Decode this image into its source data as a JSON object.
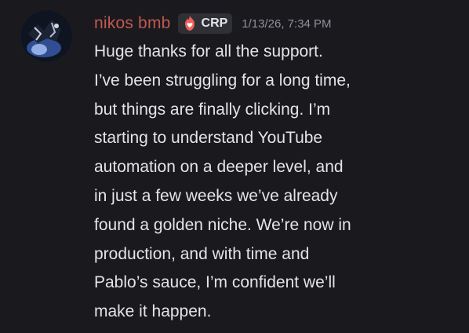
{
  "message": {
    "author": {
      "name": "nikos bmb",
      "name_color": "#c2574f",
      "avatar_icon": "user-avatar-image"
    },
    "role_tag": {
      "icon": "flame-heart-icon",
      "label": "CRP"
    },
    "timestamp": "1/13/26, 7:34 PM",
    "lines": [
      "Huge thanks for all the support.",
      "I’ve been struggling for a long time,",
      "but things are finally clicking. I’m",
      "starting to understand YouTube",
      "automation on a deeper level, and",
      "in just a few weeks we’ve already",
      "found a golden niche. We’re now in",
      "production, and with time and",
      "Pablo’s sauce, I’m confident we’ll",
      "make it happen."
    ]
  },
  "colors": {
    "background": "#1a1a1e",
    "text": "#e3e4e8",
    "timestamp": "#8f9099",
    "tag_background": "#2f2f36"
  }
}
